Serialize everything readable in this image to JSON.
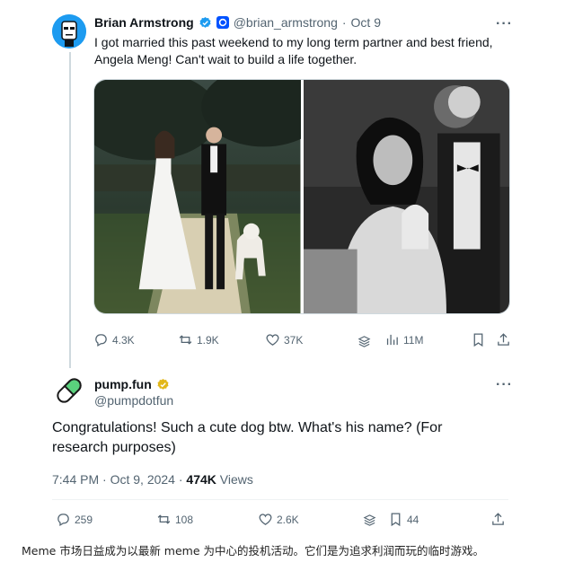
{
  "tweet": {
    "author_name": "Brian Armstrong",
    "handle": "@brian_armstrong",
    "separator": "·",
    "date": "Oct 9",
    "text_line1": "I got married this past weekend to my long term partner and best friend,",
    "text_line2": "Angela Meng! Can't wait to build a life together.",
    "stats": {
      "replies": "4.3K",
      "retweets": "1.9K",
      "likes": "37K",
      "views": "11M"
    }
  },
  "reply": {
    "author_name": "pump.fun",
    "handle": "@pumpdotfun",
    "text": "Congratulations! Such a cute dog btw. What's his name? (For research purposes)",
    "time": "7:44 PM · Oct 9, 2024 · ",
    "views_count": "474K",
    "views_label": " Views",
    "stats": {
      "replies": "259",
      "retweets": "108",
      "likes": "2.6K",
      "bookmarks": "44"
    }
  },
  "caption": "Meme 市场日益成为以最新 meme 为中心的投机活动。它们是为追求利润而玩的临时游戏。",
  "colors": {
    "verified_blue": "#1d9bf0",
    "gold_badge": "#e2b719",
    "muted_text": "#536471"
  }
}
